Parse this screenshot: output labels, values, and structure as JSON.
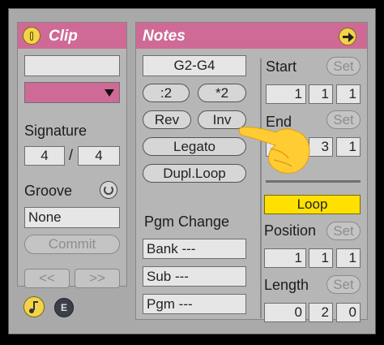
{
  "clip": {
    "title": "Clip",
    "name_value": "",
    "signature_label": "Signature",
    "sig_numerator": "4",
    "sig_separator": "/",
    "sig_denominator": "4",
    "groove_label": "Groove",
    "groove_value": "None",
    "commit_label": "Commit",
    "nudge_back_label": "<<",
    "nudge_fwd_label": ">>",
    "color_accent": "#cf6a96"
  },
  "notes": {
    "title": "Notes",
    "range_value": "G2-G4",
    "div2_label": ":2",
    "mul2_label": "*2",
    "rev_label": "Rev",
    "inv_label": "Inv",
    "legato_label": "Legato",
    "dupl_label": "Dupl.Loop",
    "pgm_change_label": "Pgm Change",
    "bank_value": "Bank ---",
    "sub_value": "Sub ---",
    "pgm_value": "Pgm ---"
  },
  "loop_section": {
    "start_label": "Start",
    "set_label": "Set",
    "start_values": [
      "1",
      "1",
      "1"
    ],
    "end_label": "End",
    "end_values": [
      "",
      "3",
      "1"
    ],
    "loop_label": "Loop",
    "loop_color": "#ffe000",
    "position_label": "Position",
    "position_values": [
      "1",
      "1",
      "1"
    ],
    "length_label": "Length",
    "length_values": [
      "0",
      "2",
      "0"
    ]
  },
  "footer": {
    "notes_icon": "music-note-icon",
    "envelope_label": "E"
  },
  "cursor": "pointing-hand-icon"
}
